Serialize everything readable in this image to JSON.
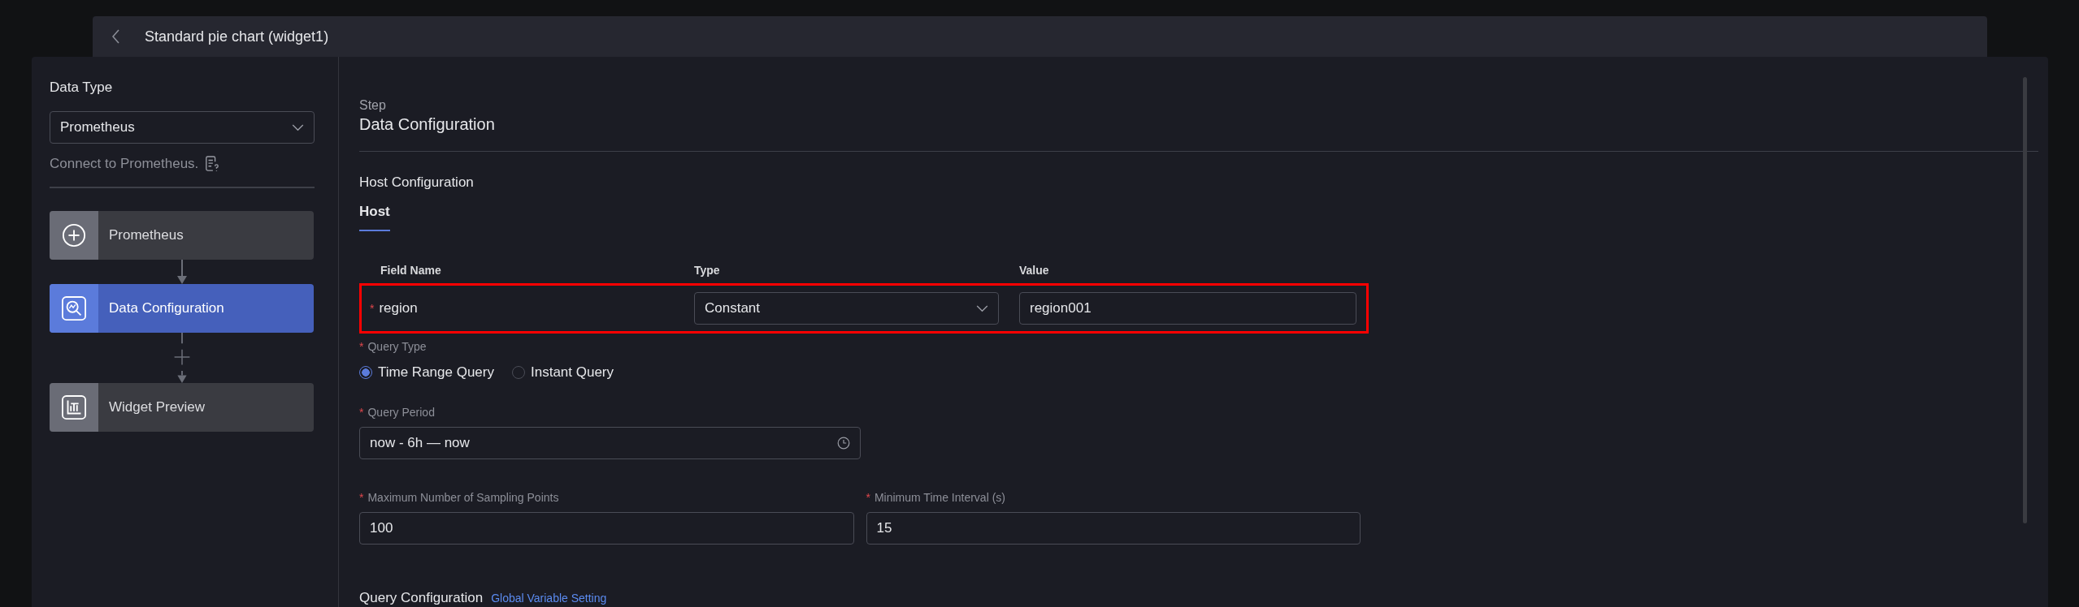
{
  "header": {
    "title": "Standard pie chart (widget1)"
  },
  "sidebar": {
    "data_type_label": "Data Type",
    "data_type_select": {
      "value": "Prometheus"
    },
    "hint": "Connect to Prometheus.",
    "steps": [
      {
        "label": "Prometheus",
        "kind": "add",
        "selected": false
      },
      {
        "label": "Data Configuration",
        "kind": "search",
        "selected": true
      },
      {
        "label": "Widget Preview",
        "kind": "chart",
        "selected": false
      }
    ],
    "connectors": [
      {
        "plus": false
      },
      {
        "plus": true
      }
    ]
  },
  "step": {
    "label": "Step",
    "title": "Data Configuration"
  },
  "host_configuration": {
    "title": "Host Configuration",
    "tabs": [
      {
        "label": "Host",
        "selected": true
      }
    ],
    "table": {
      "columns": [
        "Field Name",
        "Type",
        "Value"
      ],
      "rows": [
        {
          "field": "region",
          "required_mark": "*",
          "type": "Constant",
          "value": "region001",
          "highlighted": true
        }
      ]
    }
  },
  "query_type": {
    "label": "Query Type",
    "required_mark": "*",
    "options": [
      {
        "label": "Time Range Query",
        "selected": true
      },
      {
        "label": "Instant Query",
        "selected": false
      }
    ]
  },
  "query_period": {
    "label": "Query Period",
    "required_mark": "*",
    "value": "now - 6h — now"
  },
  "sampling_points": {
    "label": "Maximum Number of Sampling Points",
    "required_mark": "*",
    "value": "100"
  },
  "min_interval": {
    "label": "Minimum Time Interval (s)",
    "required_mark": "*",
    "value": "15"
  },
  "query_configuration": {
    "title": "Query Configuration",
    "link": "Global Variable Setting"
  }
}
